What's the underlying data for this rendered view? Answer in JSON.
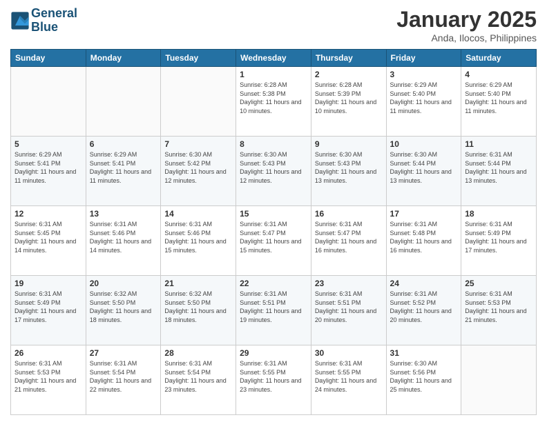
{
  "header": {
    "logo_line1": "General",
    "logo_line2": "Blue",
    "month": "January 2025",
    "location": "Anda, Ilocos, Philippines"
  },
  "days_of_week": [
    "Sunday",
    "Monday",
    "Tuesday",
    "Wednesday",
    "Thursday",
    "Friday",
    "Saturday"
  ],
  "weeks": [
    [
      {
        "day": "",
        "sunrise": "",
        "sunset": "",
        "daylight": ""
      },
      {
        "day": "",
        "sunrise": "",
        "sunset": "",
        "daylight": ""
      },
      {
        "day": "",
        "sunrise": "",
        "sunset": "",
        "daylight": ""
      },
      {
        "day": "1",
        "sunrise": "Sunrise: 6:28 AM",
        "sunset": "Sunset: 5:38 PM",
        "daylight": "Daylight: 11 hours and 10 minutes."
      },
      {
        "day": "2",
        "sunrise": "Sunrise: 6:28 AM",
        "sunset": "Sunset: 5:39 PM",
        "daylight": "Daylight: 11 hours and 10 minutes."
      },
      {
        "day": "3",
        "sunrise": "Sunrise: 6:29 AM",
        "sunset": "Sunset: 5:40 PM",
        "daylight": "Daylight: 11 hours and 11 minutes."
      },
      {
        "day": "4",
        "sunrise": "Sunrise: 6:29 AM",
        "sunset": "Sunset: 5:40 PM",
        "daylight": "Daylight: 11 hours and 11 minutes."
      }
    ],
    [
      {
        "day": "5",
        "sunrise": "Sunrise: 6:29 AM",
        "sunset": "Sunset: 5:41 PM",
        "daylight": "Daylight: 11 hours and 11 minutes."
      },
      {
        "day": "6",
        "sunrise": "Sunrise: 6:29 AM",
        "sunset": "Sunset: 5:41 PM",
        "daylight": "Daylight: 11 hours and 11 minutes."
      },
      {
        "day": "7",
        "sunrise": "Sunrise: 6:30 AM",
        "sunset": "Sunset: 5:42 PM",
        "daylight": "Daylight: 11 hours and 12 minutes."
      },
      {
        "day": "8",
        "sunrise": "Sunrise: 6:30 AM",
        "sunset": "Sunset: 5:43 PM",
        "daylight": "Daylight: 11 hours and 12 minutes."
      },
      {
        "day": "9",
        "sunrise": "Sunrise: 6:30 AM",
        "sunset": "Sunset: 5:43 PM",
        "daylight": "Daylight: 11 hours and 13 minutes."
      },
      {
        "day": "10",
        "sunrise": "Sunrise: 6:30 AM",
        "sunset": "Sunset: 5:44 PM",
        "daylight": "Daylight: 11 hours and 13 minutes."
      },
      {
        "day": "11",
        "sunrise": "Sunrise: 6:31 AM",
        "sunset": "Sunset: 5:44 PM",
        "daylight": "Daylight: 11 hours and 13 minutes."
      }
    ],
    [
      {
        "day": "12",
        "sunrise": "Sunrise: 6:31 AM",
        "sunset": "Sunset: 5:45 PM",
        "daylight": "Daylight: 11 hours and 14 minutes."
      },
      {
        "day": "13",
        "sunrise": "Sunrise: 6:31 AM",
        "sunset": "Sunset: 5:46 PM",
        "daylight": "Daylight: 11 hours and 14 minutes."
      },
      {
        "day": "14",
        "sunrise": "Sunrise: 6:31 AM",
        "sunset": "Sunset: 5:46 PM",
        "daylight": "Daylight: 11 hours and 15 minutes."
      },
      {
        "day": "15",
        "sunrise": "Sunrise: 6:31 AM",
        "sunset": "Sunset: 5:47 PM",
        "daylight": "Daylight: 11 hours and 15 minutes."
      },
      {
        "day": "16",
        "sunrise": "Sunrise: 6:31 AM",
        "sunset": "Sunset: 5:47 PM",
        "daylight": "Daylight: 11 hours and 16 minutes."
      },
      {
        "day": "17",
        "sunrise": "Sunrise: 6:31 AM",
        "sunset": "Sunset: 5:48 PM",
        "daylight": "Daylight: 11 hours and 16 minutes."
      },
      {
        "day": "18",
        "sunrise": "Sunrise: 6:31 AM",
        "sunset": "Sunset: 5:49 PM",
        "daylight": "Daylight: 11 hours and 17 minutes."
      }
    ],
    [
      {
        "day": "19",
        "sunrise": "Sunrise: 6:31 AM",
        "sunset": "Sunset: 5:49 PM",
        "daylight": "Daylight: 11 hours and 17 minutes."
      },
      {
        "day": "20",
        "sunrise": "Sunrise: 6:32 AM",
        "sunset": "Sunset: 5:50 PM",
        "daylight": "Daylight: 11 hours and 18 minutes."
      },
      {
        "day": "21",
        "sunrise": "Sunrise: 6:32 AM",
        "sunset": "Sunset: 5:50 PM",
        "daylight": "Daylight: 11 hours and 18 minutes."
      },
      {
        "day": "22",
        "sunrise": "Sunrise: 6:31 AM",
        "sunset": "Sunset: 5:51 PM",
        "daylight": "Daylight: 11 hours and 19 minutes."
      },
      {
        "day": "23",
        "sunrise": "Sunrise: 6:31 AM",
        "sunset": "Sunset: 5:51 PM",
        "daylight": "Daylight: 11 hours and 20 minutes."
      },
      {
        "day": "24",
        "sunrise": "Sunrise: 6:31 AM",
        "sunset": "Sunset: 5:52 PM",
        "daylight": "Daylight: 11 hours and 20 minutes."
      },
      {
        "day": "25",
        "sunrise": "Sunrise: 6:31 AM",
        "sunset": "Sunset: 5:53 PM",
        "daylight": "Daylight: 11 hours and 21 minutes."
      }
    ],
    [
      {
        "day": "26",
        "sunrise": "Sunrise: 6:31 AM",
        "sunset": "Sunset: 5:53 PM",
        "daylight": "Daylight: 11 hours and 21 minutes."
      },
      {
        "day": "27",
        "sunrise": "Sunrise: 6:31 AM",
        "sunset": "Sunset: 5:54 PM",
        "daylight": "Daylight: 11 hours and 22 minutes."
      },
      {
        "day": "28",
        "sunrise": "Sunrise: 6:31 AM",
        "sunset": "Sunset: 5:54 PM",
        "daylight": "Daylight: 11 hours and 23 minutes."
      },
      {
        "day": "29",
        "sunrise": "Sunrise: 6:31 AM",
        "sunset": "Sunset: 5:55 PM",
        "daylight": "Daylight: 11 hours and 23 minutes."
      },
      {
        "day": "30",
        "sunrise": "Sunrise: 6:31 AM",
        "sunset": "Sunset: 5:55 PM",
        "daylight": "Daylight: 11 hours and 24 minutes."
      },
      {
        "day": "31",
        "sunrise": "Sunrise: 6:30 AM",
        "sunset": "Sunset: 5:56 PM",
        "daylight": "Daylight: 11 hours and 25 minutes."
      },
      {
        "day": "",
        "sunrise": "",
        "sunset": "",
        "daylight": ""
      }
    ]
  ]
}
